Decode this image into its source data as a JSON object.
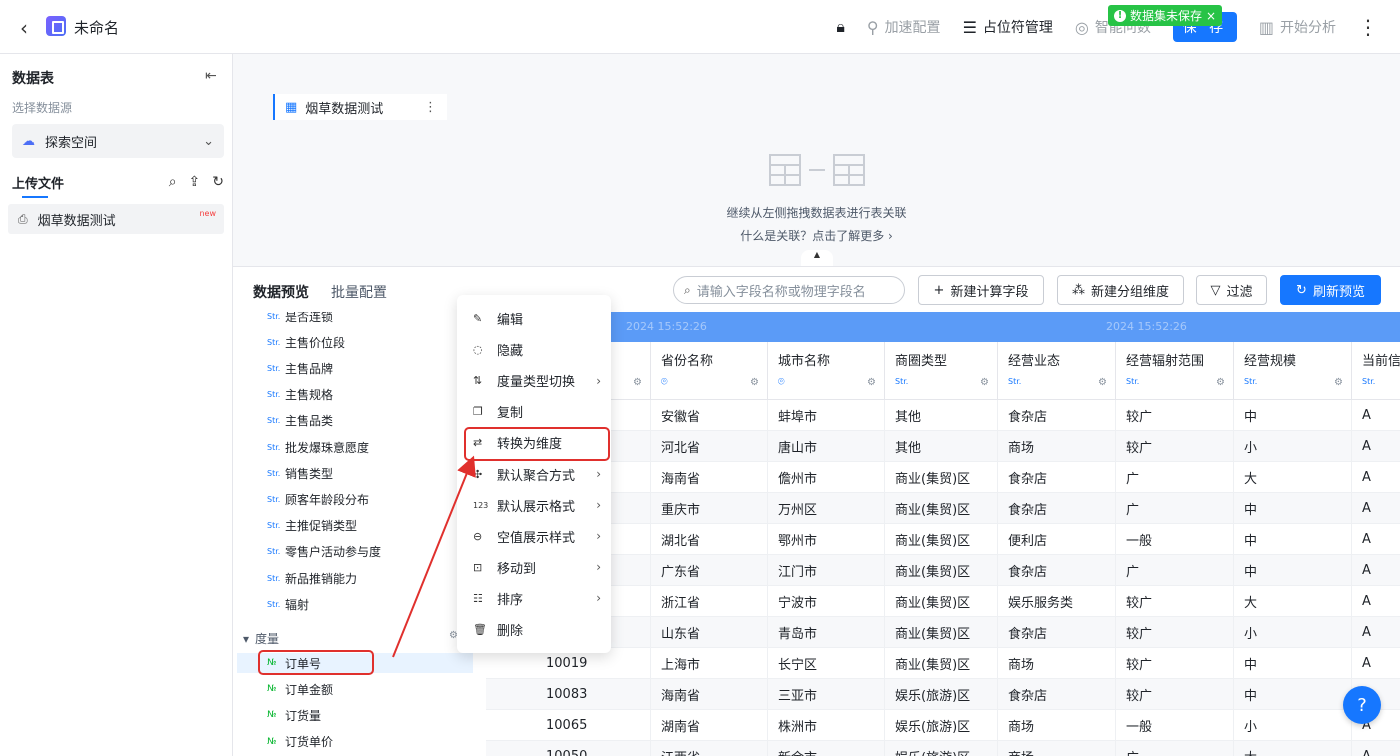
{
  "header": {
    "title": "未命名",
    "actions": {
      "accel": "加速配置",
      "placeholder": "占位符管理",
      "smart_qa": "智能问数",
      "save": "保 存",
      "analyze": "开始分析"
    },
    "unsaved_badge": "数据集未保存"
  },
  "sidebar": {
    "title": "数据表",
    "source_label": "选择数据源",
    "source_value": "探索空间",
    "upload_label": "上传文件",
    "file_name": "烟草数据测试",
    "file_badge": "new"
  },
  "canvas": {
    "table_node": "烟草数据测试",
    "hint": "继续从左侧拖拽数据表进行表关联",
    "learn_more": "什么是关联？点击了解更多 ›"
  },
  "preview": {
    "tab_active": "数据预览",
    "tab_inactive": "批量配置",
    "search_placeholder": "请输入字段名称或物理字段名",
    "new_calc": "新建计算字段",
    "new_group": "新建分组维度",
    "filter": "过滤",
    "refresh": "刷新预览"
  },
  "fields": {
    "dimensions": [
      "是否连锁",
      "主售价位段",
      "主售品牌",
      "主售规格",
      "主售品类",
      "批发爆珠意愿度",
      "销售类型",
      "顾客年龄段分布",
      "主推促销类型",
      "零售户活动参与度",
      "新品推销能力",
      "辐射"
    ],
    "dim_type": "Str.",
    "measure_header": "度量",
    "measures": [
      "订单号",
      "订单金额",
      "订货量",
      "订货单价"
    ],
    "num_type": "№"
  },
  "grid": {
    "watermark": "2024 15:52:26",
    "columns": [
      {
        "name": "省份名称",
        "kind": "geo"
      },
      {
        "name": "城市名称",
        "kind": "geo"
      },
      {
        "name": "商圈类型",
        "kind": "str"
      },
      {
        "name": "经营业态",
        "kind": "str"
      },
      {
        "name": "经营辐射范围",
        "kind": "str"
      },
      {
        "name": "经营规模",
        "kind": "str"
      },
      {
        "name": "当前信",
        "kind": "str"
      }
    ],
    "type_label": "Str.",
    "rows": [
      [
        "",
        "安徽省",
        "蚌埠市",
        "其他",
        "食杂店",
        "较广",
        "中",
        "A"
      ],
      [
        "",
        "河北省",
        "唐山市",
        "其他",
        "商场",
        "较广",
        "小",
        "A"
      ],
      [
        "",
        "海南省",
        "儋州市",
        "商业(集贸)区",
        "食杂店",
        "广",
        "大",
        "A"
      ],
      [
        "",
        "重庆市",
        "万州区",
        "商业(集贸)区",
        "食杂店",
        "广",
        "中",
        "A"
      ],
      [
        "",
        "湖北省",
        "鄂州市",
        "商业(集贸)区",
        "便利店",
        "一般",
        "中",
        "A"
      ],
      [
        "",
        "广东省",
        "江门市",
        "商业(集贸)区",
        "食杂店",
        "广",
        "中",
        "A"
      ],
      [
        "",
        "浙江省",
        "宁波市",
        "商业(集贸)区",
        "娱乐服务类",
        "较广",
        "大",
        "A"
      ],
      [
        "",
        "山东省",
        "青岛市",
        "商业(集贸)区",
        "食杂店",
        "较广",
        "小",
        "A"
      ],
      [
        "10019",
        "上海市",
        "长宁区",
        "商业(集贸)区",
        "商场",
        "较广",
        "中",
        "A"
      ],
      [
        "10083",
        "海南省",
        "三亚市",
        "娱乐(旅游)区",
        "食杂店",
        "较广",
        "中",
        "A"
      ],
      [
        "10065",
        "湖南省",
        "株洲市",
        "娱乐(旅游)区",
        "商场",
        "一般",
        "小",
        "A"
      ],
      [
        "10050",
        "江西省",
        "新余市",
        "娱乐(旅游)区",
        "商场",
        "广",
        "大",
        "A"
      ]
    ]
  },
  "context_menu": {
    "items": [
      {
        "label": "编辑",
        "icon": "edit-icon",
        "sub": false
      },
      {
        "label": "隐藏",
        "icon": "hide-icon",
        "sub": false
      },
      {
        "label": "度量类型切换",
        "icon": "switch-icon",
        "sub": true
      },
      {
        "label": "复制",
        "icon": "copy-icon",
        "sub": false
      },
      {
        "label": "转换为维度",
        "icon": "convert-icon",
        "sub": false
      },
      {
        "label": "默认聚合方式",
        "icon": "aggregate-icon",
        "sub": true
      },
      {
        "label": "默认展示格式",
        "icon": "format-icon",
        "sub": true
      },
      {
        "label": "空值展示样式",
        "icon": "null-icon",
        "sub": true
      },
      {
        "label": "移动到",
        "icon": "move-icon",
        "sub": true
      },
      {
        "label": "排序",
        "icon": "sort-icon",
        "sub": true
      },
      {
        "label": "删除",
        "icon": "delete-icon",
        "sub": false
      }
    ]
  },
  "colors": {
    "accent": "#1677ff",
    "annotation": "#e0302d",
    "success": "#27c346"
  }
}
